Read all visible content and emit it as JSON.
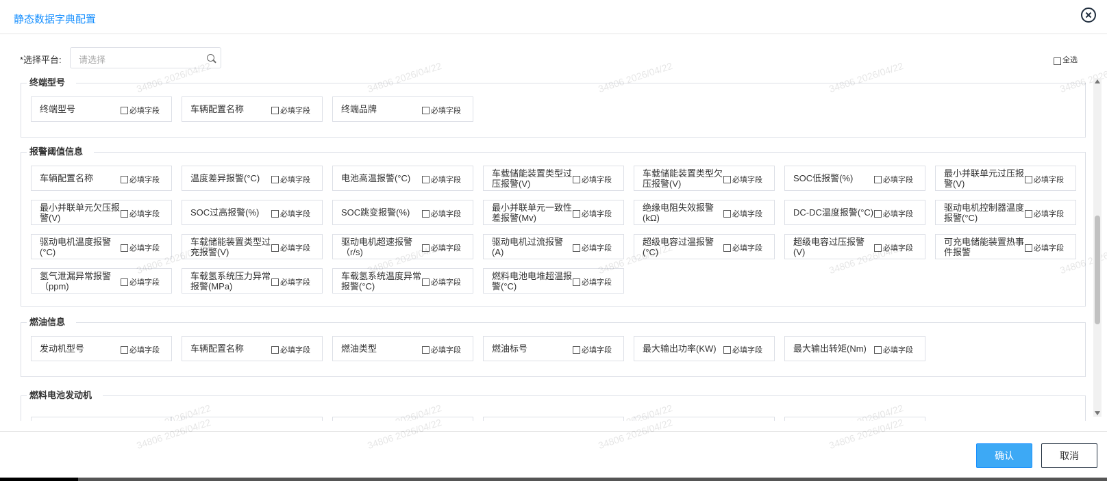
{
  "dialog": {
    "title": "静态数据字典配置"
  },
  "platform": {
    "label": "*选择平台:",
    "placeholder": "请选择"
  },
  "select_all_label": "全选",
  "required_label": "必填字段",
  "sections": [
    {
      "name": "终端型号",
      "fields": [
        {
          "label": "终端型号"
        },
        {
          "label": "车辆配置名称"
        },
        {
          "label": "终端品牌"
        }
      ]
    },
    {
      "name": "报警阈值信息",
      "fields": [
        {
          "label": "车辆配置名称"
        },
        {
          "label": "温度差异报警(°C)"
        },
        {
          "label": "电池高温报警(°C)"
        },
        {
          "label": "车载储能装置类型过压报警(V)"
        },
        {
          "label": "车载储能装置类型欠压报警(V)"
        },
        {
          "label": "SOC低报警(%)"
        },
        {
          "label": "最小并联单元过压报警(V)"
        },
        {
          "label": "最小并联单元欠压报警(V)"
        },
        {
          "label": "SOC过高报警(%)"
        },
        {
          "label": "SOC跳变报警(%)"
        },
        {
          "label": "最小并联单元一致性差报警(Mv)"
        },
        {
          "label": "绝缘电阻失效报警(kΩ)"
        },
        {
          "label": "DC-DC温度报警(°C)"
        },
        {
          "label": "驱动电机控制器温度报警(°C)"
        },
        {
          "label": "驱动电机温度报警(°C)"
        },
        {
          "label": "车载储能装置类型过充报警(V)"
        },
        {
          "label": "驱动电机超速报警（r/s)"
        },
        {
          "label": "驱动电机过流报警(A)"
        },
        {
          "label": "超级电容过温报警(°C)"
        },
        {
          "label": "超级电容过压报警(V)"
        },
        {
          "label": "可充电储能装置热事件报警"
        },
        {
          "label": "氢气泄漏异常报警（ppm)"
        },
        {
          "label": "车载氢系统压力异常报警(MPa)"
        },
        {
          "label": "车载氢系统温度异常报警(°C)"
        },
        {
          "label": "燃料电池电堆超温报警(°C)"
        }
      ]
    },
    {
      "name": "燃油信息",
      "fields": [
        {
          "label": "发动机型号"
        },
        {
          "label": "车辆配置名称"
        },
        {
          "label": "燃油类型"
        },
        {
          "label": "燃油标号"
        },
        {
          "label": "最大输出功率(KW)"
        },
        {
          "label": "最大输出转矩(Nm)"
        }
      ]
    },
    {
      "name": "燃料电池发动机",
      "fields": []
    }
  ],
  "footer": {
    "confirm_label": "确认",
    "cancel_label": "取消"
  },
  "watermark": "34806 2026/04/22",
  "colors": {
    "accent": "#1890ff",
    "confirm_bg": "#3da9f5"
  }
}
